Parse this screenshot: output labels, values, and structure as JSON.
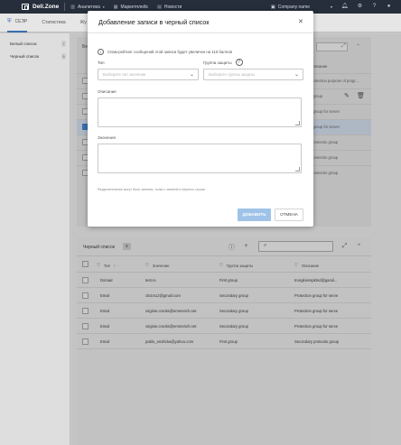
{
  "topbar": {
    "brand": "Dell.Zone",
    "nav": [
      {
        "label": "Аналитика",
        "icon": "chart-icon",
        "dropdown": true
      },
      {
        "label": "Маркетплейс",
        "icon": "grid-icon",
        "dropdown": false
      },
      {
        "label": "Новости",
        "icon": "news-icon",
        "dropdown": false
      }
    ],
    "company": "Company name"
  },
  "subbar": {
    "tabs": [
      {
        "label": "СЕЭР",
        "icon": "shield-icon",
        "active": true
      },
      {
        "label": "Статистика",
        "active": false
      },
      {
        "label": "Жу",
        "active": false
      }
    ]
  },
  "sidebar": {
    "items": [
      {
        "label": "Белый список",
        "count": "7"
      },
      {
        "label": "Черный список",
        "count": "5"
      }
    ]
  },
  "top_panel": {
    "tab_label": "Бе",
    "column": "Описание",
    "rows": [
      {
        "desc": "Protection purpose of progr..."
      },
      {
        "desc": "n group"
      },
      {
        "desc": "n group for server"
      },
      {
        "desc": "n group for server"
      },
      {
        "desc": "y protectio group"
      },
      {
        "desc": "y protectio group"
      },
      {
        "desc": "y protectio group"
      }
    ]
  },
  "blacklist": {
    "title": "Черный список",
    "count": "5",
    "columns": {
      "type": "Тип",
      "value": "Значение",
      "group": "Группа защиты",
      "desc": "Описание"
    },
    "rows": [
      {
        "type": "Domain",
        "value": "test.ru",
        "group": "First group",
        "desc": "trungkienspktnd@gamil..."
      },
      {
        "type": "Email",
        "value": "ckctm12@gmail.com",
        "group": "Secondary group",
        "desc": "Protection group for serve"
      },
      {
        "type": "Email",
        "value": "virginie.crooks@emmerich.net",
        "group": "Secondary group",
        "desc": "Protection group for serve"
      },
      {
        "type": "Email",
        "value": "virginie.crooks@emmerich.net",
        "group": "Secondary group",
        "desc": "Protection group for serve"
      },
      {
        "type": "Email",
        "value": "pablo_endrickа@yahoo.com",
        "group": "First group",
        "desc": "Secondary protectio group"
      }
    ]
  },
  "modal": {
    "title": "Добавление записи в черный список",
    "info": "Спам-рейтинг сообщений этой записи будет увеличен на 110 баллов",
    "type_label": "Тип",
    "type_placeholder": "Выберите тип значения",
    "group_label": "Группа защиты",
    "group_placeholder": "Выберите группы защиты",
    "desc_label": "Описание",
    "values_label": "Значения",
    "hint": "Разделительные могут быть запятая, точка с запятой и перенос строки",
    "add_button": "ДОБАВИТЬ",
    "cancel_button": "ОТМЕНА"
  },
  "colors": {
    "topbar": "#262e3b",
    "accent": "#3b6fae",
    "add_button": "#9fc3e8"
  }
}
